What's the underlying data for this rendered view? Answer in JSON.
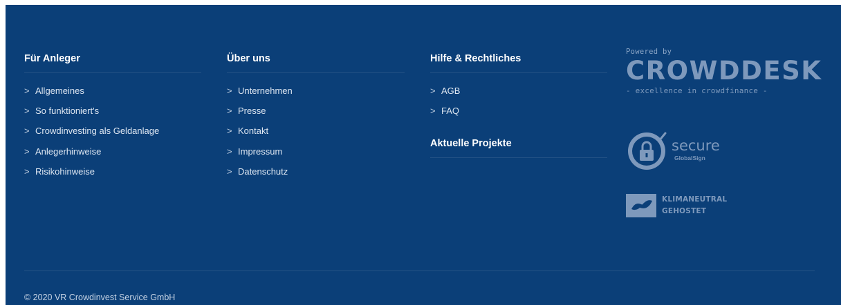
{
  "columns": {
    "anleger": {
      "heading": "Für Anleger",
      "links": [
        "Allgemeines",
        "So funktioniert's",
        "Crowdinvesting als Geldanlage",
        "Anlegerhinweise",
        "Risikohinweise"
      ]
    },
    "ueber": {
      "heading": "Über uns",
      "links": [
        "Unternehmen",
        "Presse",
        "Kontakt",
        "Impressum",
        "Datenschutz"
      ]
    },
    "hilfe": {
      "heading": "Hilfe & Rechtliches",
      "links": [
        "AGB",
        "FAQ"
      ],
      "projects_heading": "Aktuelle Projekte"
    }
  },
  "brand": {
    "powered_by": "Powered by",
    "logo": "CROWDDESK",
    "tagline": "- excellence in crowdfinance -",
    "secure_word": "secure",
    "secure_provider": "GlobalSign",
    "klima_line1": "KLIMANEUTRAL",
    "klima_line2": "GEHOSTET"
  },
  "copyright": "© 2020 VR Crowdinvest Service GmbH",
  "colors": {
    "background": "#0b3f78",
    "muted_logo": "#7e99bc"
  }
}
